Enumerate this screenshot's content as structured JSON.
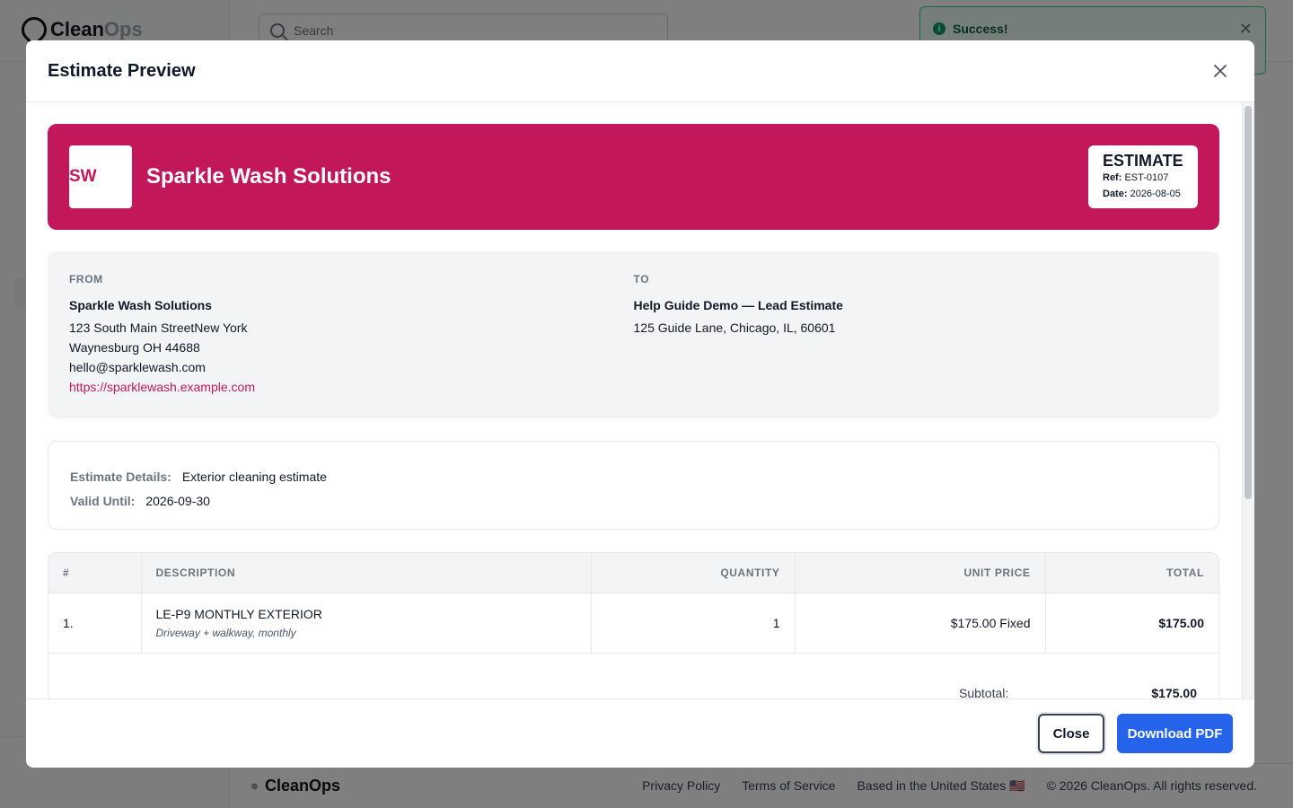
{
  "app": {
    "brand_clean": "Clean",
    "brand_ops": "Ops",
    "search_placeholder": "Search",
    "toast_text": "Success!",
    "footer": {
      "brand": "CleanOps",
      "links": [
        "Privacy Policy",
        "Terms of Service",
        "Based in the United States 🇺🇸",
        "© 2026 CleanOps. All rights reserved."
      ]
    }
  },
  "modal": {
    "title": "Estimate Preview",
    "close_label": "Close",
    "download_label": "Download PDF"
  },
  "estimate": {
    "logo_initials": "SW",
    "company_name": "Sparkle Wash Solutions",
    "doc_title": "ESTIMATE",
    "ref_label": "Ref:",
    "ref_value": "EST-0107",
    "date_label": "Date:",
    "date_value": "2026-08-05",
    "brand_color": "#c2185b",
    "from": {
      "label": "FROM",
      "name": "Sparkle Wash Solutions",
      "address_line1": "123 South Main StreetNew York",
      "address_line2": "Waynesburg OH 44688",
      "email": "hello@sparklewash.com",
      "website": "https://sparklewash.example.com"
    },
    "to": {
      "label": "TO",
      "name": "Help Guide Demo — Lead Estimate",
      "address": "125 Guide Lane, Chicago, IL, 60601"
    },
    "details": {
      "details_label": "Estimate Details:",
      "details_value": "Exterior cleaning estimate",
      "valid_label": "Valid Until:",
      "valid_value": "2026-09-30"
    },
    "table": {
      "headers": [
        "#",
        "DESCRIPTION",
        "QUANTITY",
        "UNIT PRICE",
        "TOTAL"
      ],
      "rows": [
        {
          "num": "1.",
          "description": "LE-P9 MONTHLY EXTERIOR",
          "sub_description": "Driveway + walkway, monthly",
          "quantity": "1",
          "unit_price": "$175.00 Fixed",
          "total": "$175.00"
        }
      ],
      "subtotal_label": "Subtotal:",
      "subtotal_value": "$175.00"
    }
  }
}
